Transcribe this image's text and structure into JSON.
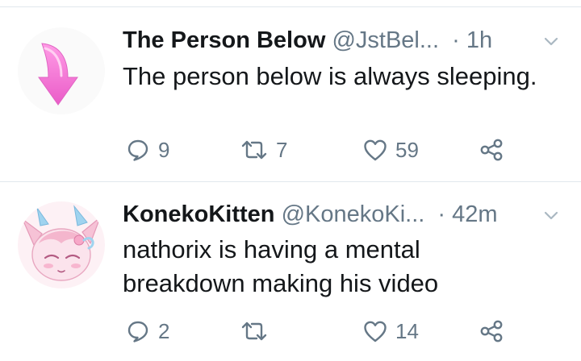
{
  "tweets": [
    {
      "display_name": "The Person Below",
      "handle": "@JstBel...",
      "time": "· 1h",
      "text": "The person below is always sleeping.",
      "replies": "9",
      "retweets": "7",
      "likes": "59",
      "avatar_icon": "pink-curved-arrow-icon"
    },
    {
      "display_name": "KonekoKitten",
      "handle": "@KonekoKi...",
      "time": "· 42m",
      "text_lines": [
        "nathorix is having a mental",
        "breakdown making his video"
      ],
      "replies": "2",
      "retweets": "",
      "likes": "14",
      "avatar_icon": "pink-anime-creature-avatar"
    }
  ],
  "colors": {
    "text": "#14171a",
    "secondary": "#657786",
    "divider": "#e1e8ed",
    "arrow_pink": "#f47ad6"
  }
}
